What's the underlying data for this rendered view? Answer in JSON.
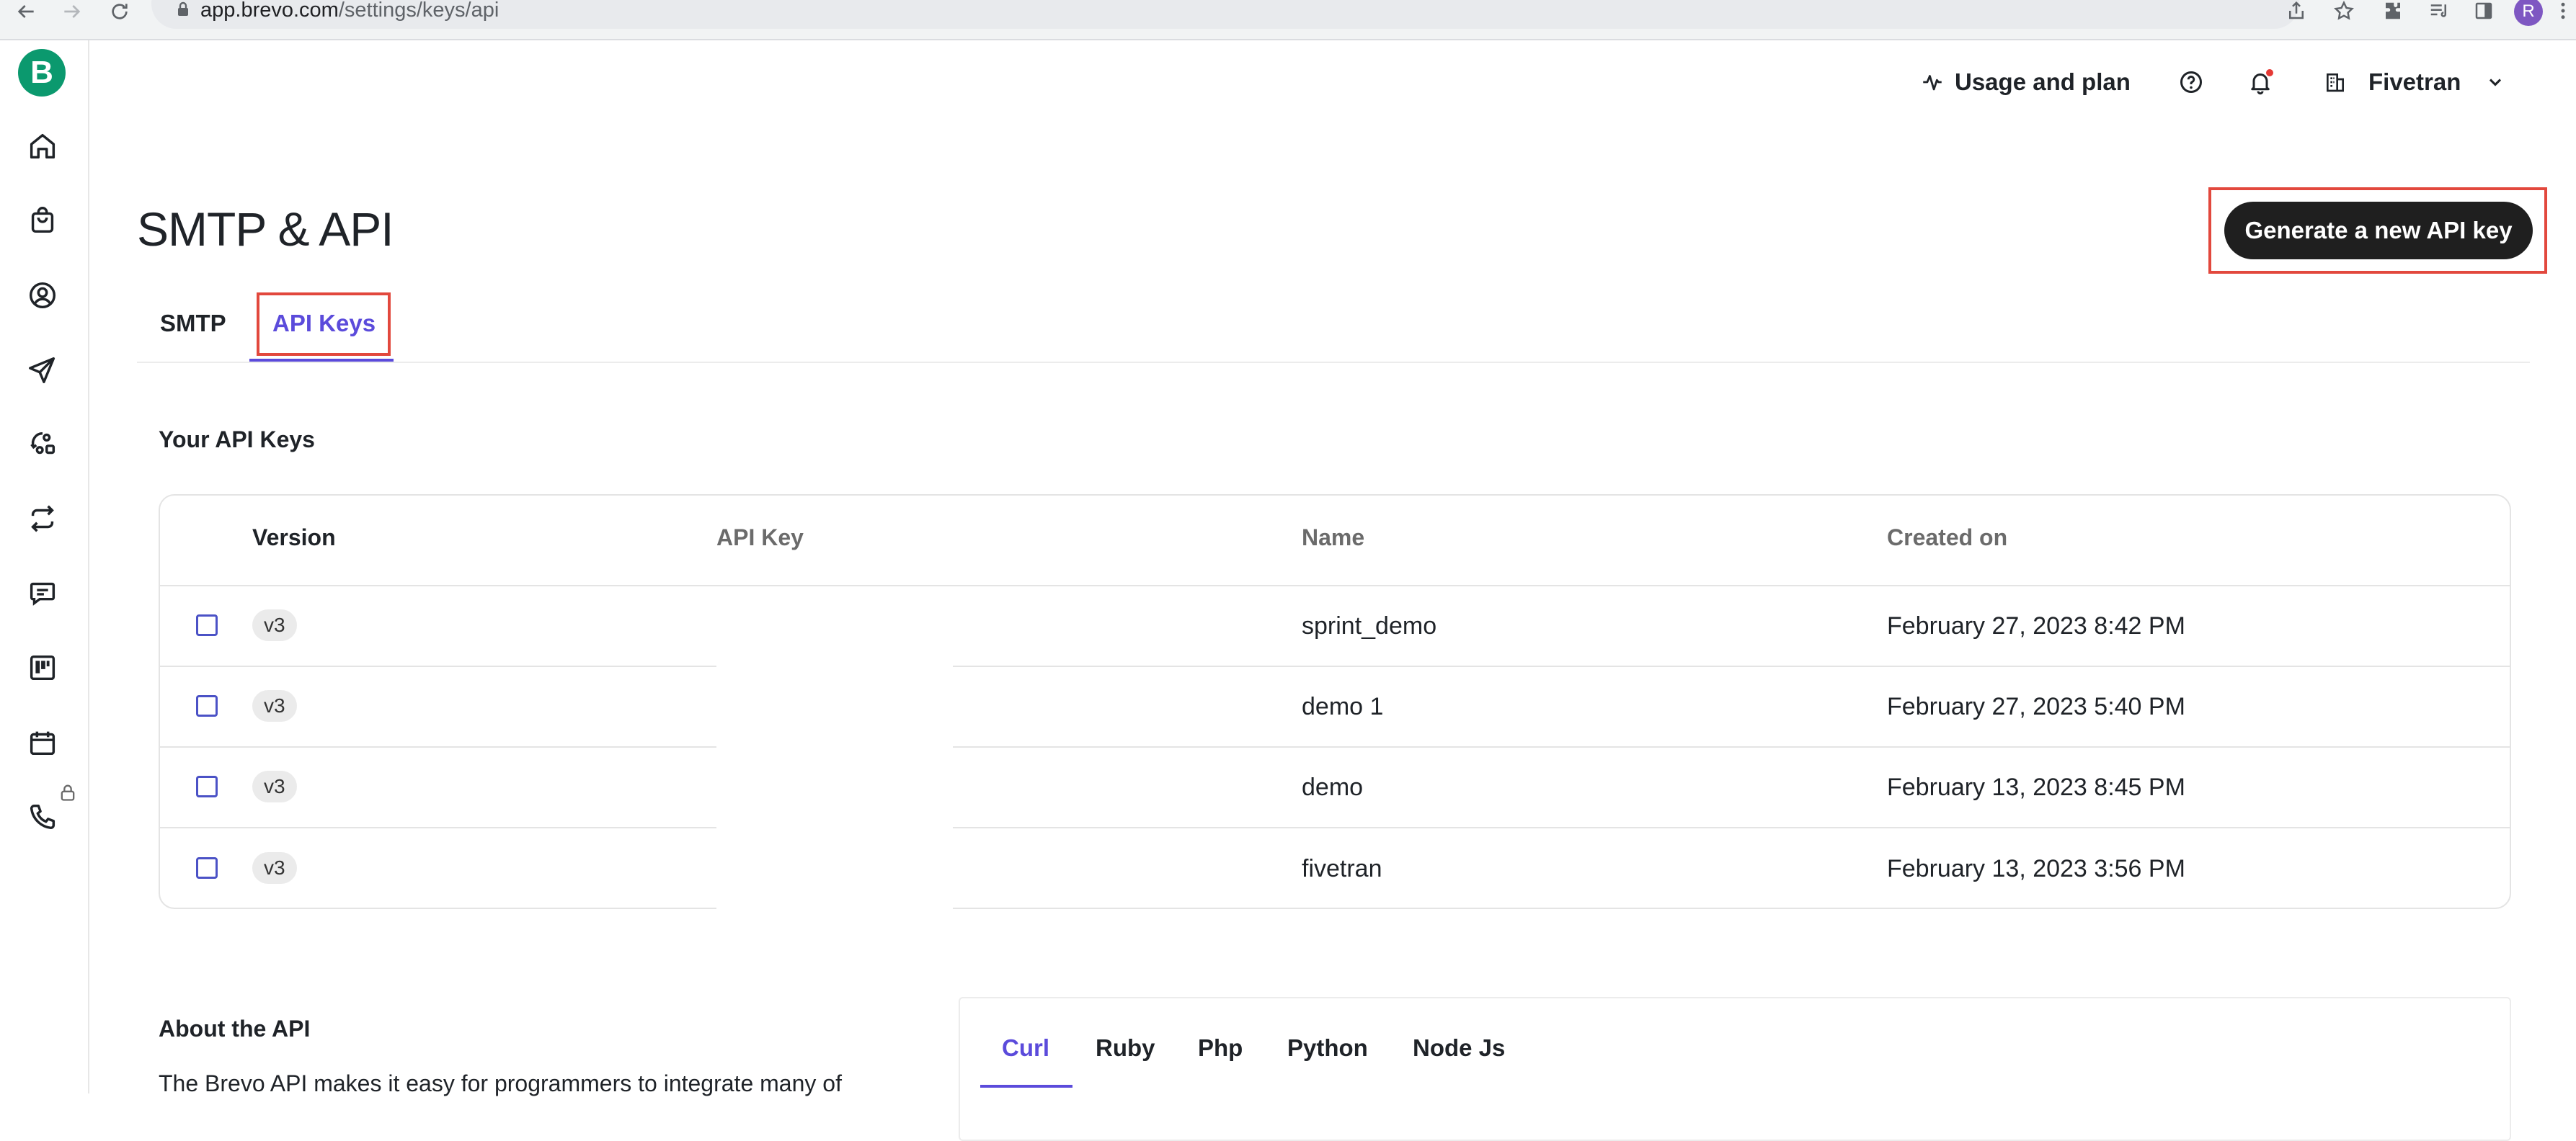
{
  "browser": {
    "url_host": "app.brevo.com",
    "url_path": "/settings/keys/api",
    "profile_initial": "R"
  },
  "sidebar": {
    "logo_letter": "B",
    "items": [
      {
        "icon": "home-icon"
      },
      {
        "icon": "shopping-bag-icon"
      },
      {
        "icon": "contacts-icon"
      },
      {
        "icon": "send-icon"
      },
      {
        "icon": "automation-icon"
      },
      {
        "icon": "transactional-icon"
      },
      {
        "icon": "conversations-icon"
      },
      {
        "icon": "deals-icon"
      },
      {
        "icon": "calendar-icon"
      },
      {
        "icon": "phone-icon",
        "locked": true
      }
    ]
  },
  "header": {
    "usage_label": "Usage and plan",
    "account_name": "Fivetran"
  },
  "page": {
    "title": "SMTP & API",
    "generate_button": "Generate a new API key",
    "tabs": [
      {
        "label": "SMTP",
        "active": false
      },
      {
        "label": "API Keys",
        "active": true
      }
    ]
  },
  "api_keys": {
    "section_title": "Your API Keys",
    "columns": [
      "Version",
      "API Key",
      "Name",
      "Created on"
    ],
    "rows": [
      {
        "version": "v3",
        "api_key": "",
        "name": "sprint_demo",
        "created_on": "February 27, 2023 8:42 PM"
      },
      {
        "version": "v3",
        "api_key": "",
        "name": "demo 1",
        "created_on": "February 27, 2023 5:40 PM"
      },
      {
        "version": "v3",
        "api_key": "",
        "name": "demo",
        "created_on": "February 13, 2023 8:45 PM"
      },
      {
        "version": "v3",
        "api_key": "",
        "name": "fivetran",
        "created_on": "February 13, 2023 3:56 PM"
      }
    ]
  },
  "about": {
    "title": "About the API",
    "text": "The Brevo API makes it easy for programmers to integrate many of",
    "language_tabs": [
      {
        "label": "Curl",
        "active": true
      },
      {
        "label": "Ruby",
        "active": false
      },
      {
        "label": "Php",
        "active": false
      },
      {
        "label": "Python",
        "active": false
      },
      {
        "label": "Node Js",
        "active": false
      }
    ]
  },
  "colors": {
    "accent": "#5b4bdb",
    "brand_green": "#0b996e",
    "highlight": "#e2483d",
    "button_dark": "#1f1f1f"
  }
}
